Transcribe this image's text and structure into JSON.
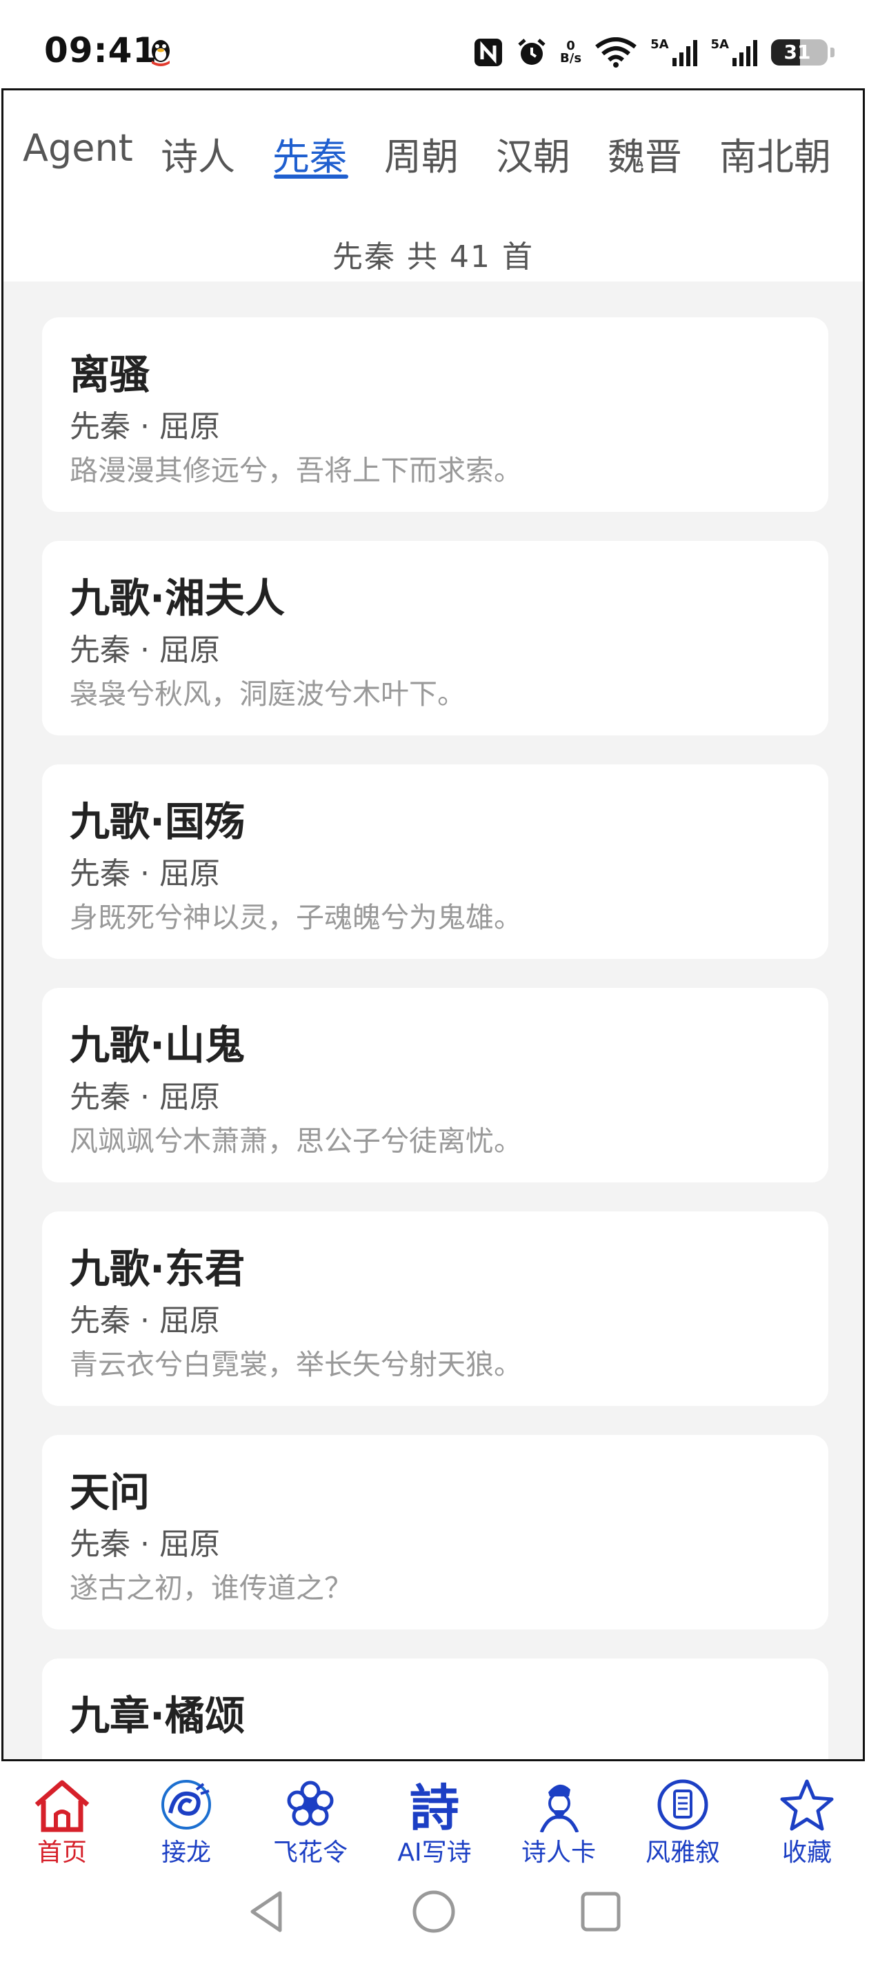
{
  "status_bar": {
    "time": "09:41",
    "net_speed_top": "0",
    "net_speed_bottom": "B/s",
    "sim1_label": "5A",
    "sim2_label": "5A",
    "battery": "31"
  },
  "tabs": [
    {
      "label": "Agent",
      "active": false
    },
    {
      "label": "诗人",
      "active": false
    },
    {
      "label": "先秦",
      "active": true
    },
    {
      "label": "周朝",
      "active": false
    },
    {
      "label": "汉朝",
      "active": false
    },
    {
      "label": "魏晋",
      "active": false
    },
    {
      "label": "南北朝",
      "active": false
    }
  ],
  "summary": {
    "text": "先秦 共 41 首"
  },
  "poems": [
    {
      "title": "离骚",
      "meta": "先秦 · 屈原",
      "line": "路漫漫其修远兮，吾将上下而求索。"
    },
    {
      "title": "九歌·湘夫人",
      "meta": "先秦 · 屈原",
      "line": "袅袅兮秋风，洞庭波兮木叶下。"
    },
    {
      "title": "九歌·国殇",
      "meta": "先秦 · 屈原",
      "line": "身既死兮神以灵，子魂魄兮为鬼雄。"
    },
    {
      "title": "九歌·山鬼",
      "meta": "先秦 · 屈原",
      "line": "风飒飒兮木萧萧，思公子兮徒离忧。"
    },
    {
      "title": "九歌·东君",
      "meta": "先秦 · 屈原",
      "line": "青云衣兮白霓裳，举长矢兮射天狼。"
    },
    {
      "title": "天问",
      "meta": "先秦 · 屈原",
      "line": "遂古之初，谁传道之？"
    },
    {
      "title": "九章·橘颂",
      "meta": "",
      "line": ""
    }
  ],
  "bottom_nav": [
    {
      "label": "首页",
      "icon": "home-icon",
      "active": true
    },
    {
      "label": "接龙",
      "icon": "dragon-icon",
      "active": false
    },
    {
      "label": "飞花令",
      "icon": "flower-icon",
      "active": false
    },
    {
      "label": "AI写诗",
      "icon": "poem-char-icon",
      "active": false
    },
    {
      "label": "诗人卡",
      "icon": "poet-portrait-icon",
      "active": false
    },
    {
      "label": "风雅叙",
      "icon": "scroll-icon",
      "active": false
    },
    {
      "label": "收藏",
      "icon": "star-icon",
      "active": false
    }
  ],
  "icon_glyphs": {
    "poem_char": "詩"
  },
  "colors": {
    "accent": "#1f5fcf",
    "home_red": "#d6202a",
    "nav_blue": "#1c3fc4",
    "list_bg": "#f3f3f3"
  }
}
